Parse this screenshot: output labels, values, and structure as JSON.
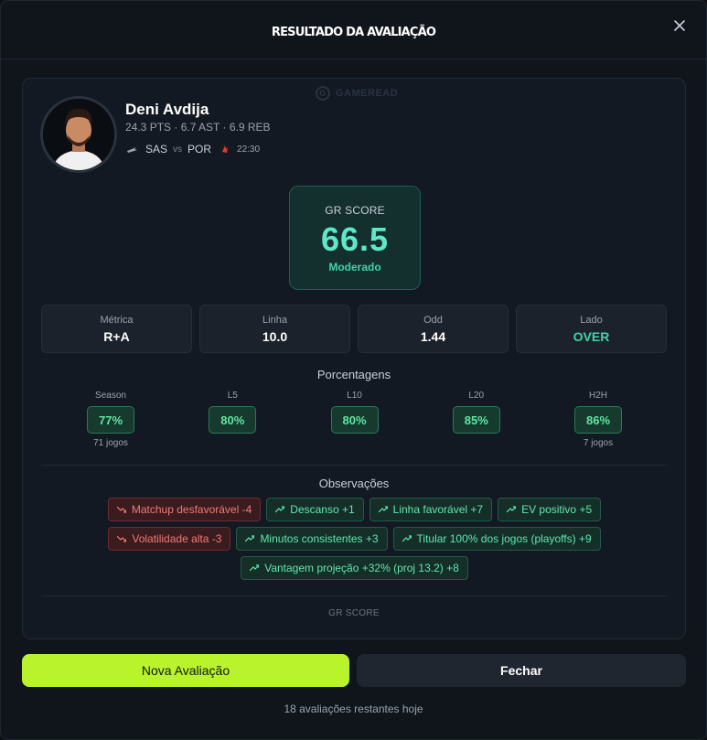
{
  "modal": {
    "title": "RESULTADO DA AVALIAÇÃO",
    "close_icon": "close-icon"
  },
  "watermark": {
    "text": "GAMEREAD",
    "logo": "G"
  },
  "player": {
    "name": "Deni Avdija",
    "stats": "24.3 PTS · 6.7 AST · 6.9 REB",
    "home_team": "SAS",
    "vs": "vs",
    "away_team": "POR",
    "time": "22:30"
  },
  "score": {
    "label": "GR SCORE",
    "value": "66.5",
    "level": "Moderado"
  },
  "metrics": [
    {
      "label": "Métrica",
      "value": "R+A"
    },
    {
      "label": "Linha",
      "value": "10.0"
    },
    {
      "label": "Odd",
      "value": "1.44"
    },
    {
      "label": "Lado",
      "value": "OVER"
    }
  ],
  "percentages": {
    "title": "Porcentagens",
    "items": [
      {
        "label": "Season",
        "value": "77%",
        "sub": "71 jogos"
      },
      {
        "label": "L5",
        "value": "80%",
        "sub": ""
      },
      {
        "label": "L10",
        "value": "80%",
        "sub": ""
      },
      {
        "label": "L20",
        "value": "85%",
        "sub": ""
      },
      {
        "label": "H2H",
        "value": "86%",
        "sub": "7 jogos"
      }
    ]
  },
  "observations": {
    "title": "Observações",
    "tags": [
      {
        "text": "Matchup desfavorável -4",
        "type": "negative"
      },
      {
        "text": "Descanso +1",
        "type": "positive"
      },
      {
        "text": "Linha favorável +7",
        "type": "positive"
      },
      {
        "text": "EV positivo +5",
        "type": "positive"
      },
      {
        "text": "Volatilidade alta -3",
        "type": "negative"
      },
      {
        "text": "Minutos consistentes +3",
        "type": "positive"
      },
      {
        "text": "Titular 100% dos jogos (playoffs) +9",
        "type": "positive"
      },
      {
        "text": "Vantagem projeção +32% (proj 13.2) +8",
        "type": "positive"
      }
    ]
  },
  "footer_label": "GR SCORE",
  "buttons": {
    "new": "Nova Avaliação",
    "close": "Fechar"
  },
  "remaining": "18 avaliações restantes hoje",
  "colors": {
    "accent": "#b8f32b",
    "score": "#5ee8c8",
    "positive": "#5ee8b0",
    "negative": "#f07a7a",
    "panel": "#131922"
  }
}
